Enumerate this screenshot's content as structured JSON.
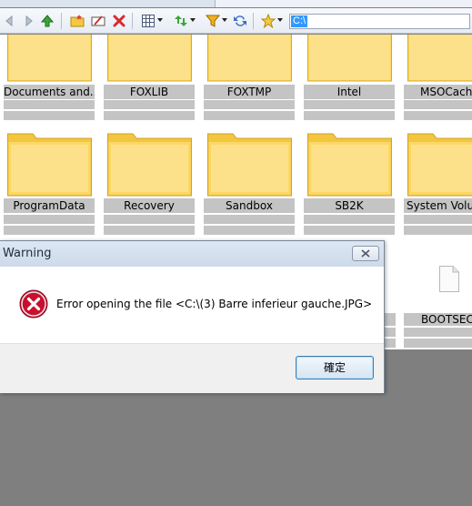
{
  "title_strip": {
    "text": ""
  },
  "toolbar": {
    "icons": [
      "back-icon",
      "forward-icon",
      "up-icon",
      "new-folder-icon",
      "rename-icon",
      "delete-icon",
      "view-icon",
      "sort-icon",
      "filter-icon",
      "refresh-icon",
      "favorites-icon"
    ],
    "address_value": "C:\\"
  },
  "folders_row1": [
    {
      "label": "Documents and..."
    },
    {
      "label": "FOXLIB"
    },
    {
      "label": "FOXTMP"
    },
    {
      "label": "Intel"
    },
    {
      "label": "MSOCach"
    }
  ],
  "folders_row2": [
    {
      "label": "ProgramData"
    },
    {
      "label": "Recovery"
    },
    {
      "label": "Sandbox"
    },
    {
      "label": "SB2K"
    },
    {
      "label": "System Volu"
    }
  ],
  "row3": {
    "file_label": "BOOTSEC"
  },
  "dialog": {
    "title": "Warning",
    "message": "Error opening the file <C:\\(3) Barre inferieur gauche.JPG>",
    "ok_label": "確定"
  },
  "colors": {
    "folder_yellow": "#f9d65c",
    "label_gray": "#c4c4c4",
    "error_red": "#c8102e",
    "backdrop_gray": "#7f7f7f"
  }
}
